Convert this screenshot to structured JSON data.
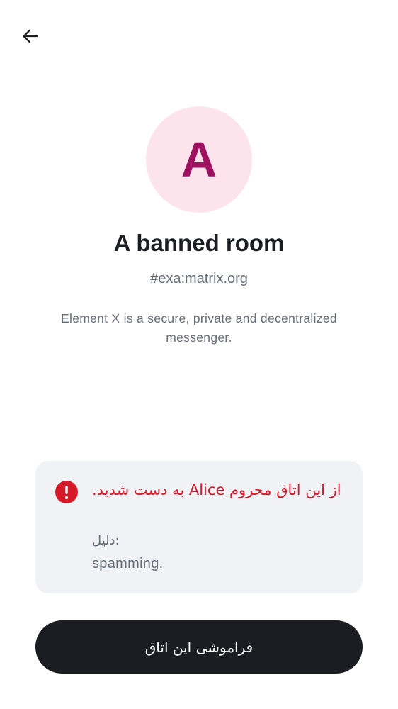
{
  "header": {
    "back_icon": "arrow-left-icon"
  },
  "room": {
    "avatar_letter": "A",
    "avatar_bg": "#fde4ec",
    "avatar_fg": "#a01060",
    "name": "A banned room",
    "alias": "#exa:matrix.org",
    "description": "Element X is a secure, private and decentralized messenger."
  },
  "ban_notice": {
    "icon": "error-icon",
    "title": "از این اتاق محروم Alice به دست شدید.",
    "reason_label": "دلیل:",
    "reason_value": "spamming.",
    "error_color": "#d51928"
  },
  "actions": {
    "forget_label": "فراموشی این اتاق"
  }
}
